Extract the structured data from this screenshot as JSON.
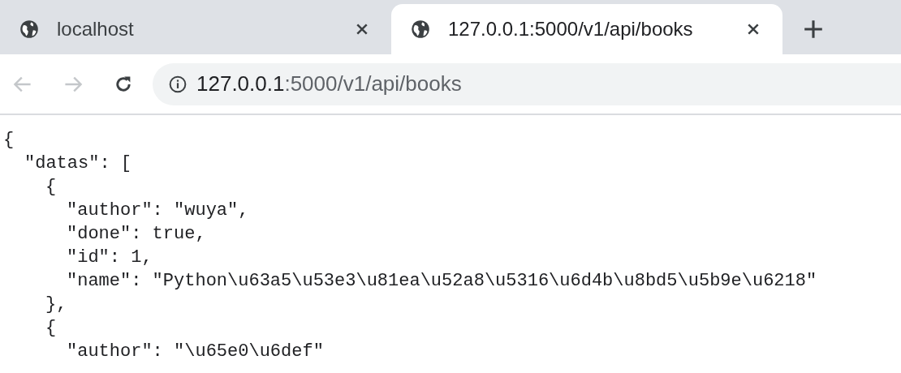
{
  "tabs": [
    {
      "title": "localhost",
      "selected": false
    },
    {
      "title": "127.0.0.1:5000/v1/api/books",
      "selected": true
    }
  ],
  "nav": {
    "back_disabled": true,
    "forward_disabled": true
  },
  "address_bar": {
    "host": "127.0.0.1",
    "path": ":5000/v1/api/books"
  },
  "content": [
    {
      "text": "{",
      "children": [
        {
          "text": "\"datas\": [",
          "children": [
            {
              "text": "{",
              "children": [
                {
                  "text": "\"author\": \"wuya\","
                },
                {
                  "text": "\"done\": true,"
                },
                {
                  "text": "\"id\": 1,"
                },
                {
                  "text": "\"name\": \"Python\\u63a5\\u53e3\\u81ea\\u52a8\\u5316\\u6d4b\\u8bd5\\u5b9e\\u6218\""
                }
              ]
            },
            {
              "text": "},"
            },
            {
              "text": "{",
              "children": [
                {
                  "text": "\"author\": \"\\u65e0\\u6def\""
                }
              ]
            }
          ]
        }
      ]
    }
  ]
}
